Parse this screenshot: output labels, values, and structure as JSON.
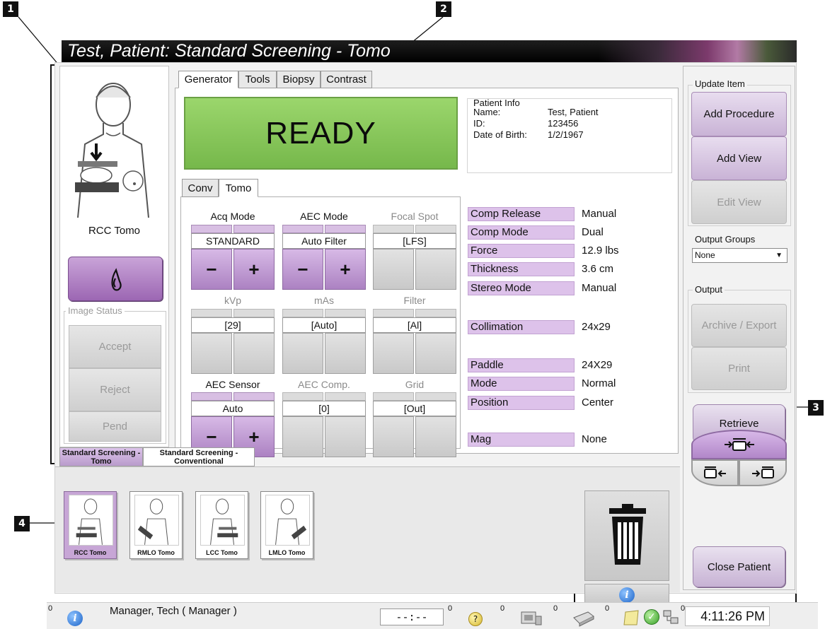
{
  "callouts": [
    "1",
    "2",
    "3",
    "4"
  ],
  "window": {
    "title": "Test, Patient:  Standard Screening - Tomo"
  },
  "left_panel": {
    "view_label": "RCC Tomo",
    "image_status_legend": "Image Status",
    "buttons": {
      "accept": "Accept",
      "reject": "Reject",
      "pend": "Pend"
    }
  },
  "tabs": [
    "Generator",
    "Tools",
    "Biopsy",
    "Contrast"
  ],
  "ready_text": "READY",
  "patient_info": {
    "legend": "Patient Info",
    "name_label": "Name:",
    "name": "Test, Patient",
    "id_label": "ID:",
    "id": "123456",
    "dob_label": "Date of Birth:",
    "dob": "1/2/1967"
  },
  "sub_tabs": [
    "Conv",
    "Tomo"
  ],
  "controls": {
    "acq_mode": {
      "label": "Acq Mode",
      "value": "STANDARD",
      "minus": "−",
      "plus": "+"
    },
    "aec_mode": {
      "label": "AEC Mode",
      "value": "Auto Filter",
      "minus": "−",
      "plus": "+"
    },
    "focal_spot": {
      "label": "Focal Spot",
      "value": "[LFS]"
    },
    "kvp": {
      "label": "kVp",
      "value": "[29]"
    },
    "mas": {
      "label": "mAs",
      "value": "[Auto]"
    },
    "filter": {
      "label": "Filter",
      "value": "[Al]"
    },
    "aec_sensor": {
      "label": "AEC Sensor",
      "value": "Auto",
      "minus": "−",
      "plus": "+"
    },
    "aec_comp": {
      "label": "AEC Comp.",
      "value": "[0]"
    },
    "grid": {
      "label": "Grid",
      "value": "[Out]"
    }
  },
  "settings": [
    {
      "key": "Comp Release",
      "value": "Manual"
    },
    {
      "key": "Comp Mode",
      "value": "Dual"
    },
    {
      "key": "Force",
      "value": "12.9 lbs"
    },
    {
      "key": "Thickness",
      "value": "3.6 cm"
    },
    {
      "key": "Stereo Mode",
      "value": "Manual"
    },
    {
      "key": "Collimation",
      "value": "24x29"
    },
    {
      "key": "Paddle",
      "value": "24X29"
    },
    {
      "key": "Mode",
      "value": "Normal"
    },
    {
      "key": "Position",
      "value": "Center"
    },
    {
      "key": "Mag",
      "value": "None"
    }
  ],
  "right_panel": {
    "update_item_legend": "Update Item",
    "add_procedure": "Add Procedure",
    "add_view": "Add View",
    "edit_view": "Edit View",
    "output_groups_legend": "Output Groups",
    "output_groups_selected": "None",
    "output_legend": "Output",
    "archive_export": "Archive / Export",
    "print": "Print",
    "retrieve": "Retrieve",
    "close_patient": "Close Patient"
  },
  "procedure_tabs": [
    "Standard Screening - Tomo",
    "Standard Screening - Conventional"
  ],
  "thumbnails": [
    "RCC Tomo",
    "RMLO Tomo",
    "LCC Tomo",
    "LMLO Tomo"
  ],
  "status_bar": {
    "user": "Manager, Tech ( Manager )",
    "counter": "--:--",
    "counts": [
      "0",
      "0",
      "0",
      "0",
      "0",
      "0"
    ],
    "time": "4:11:26 PM"
  },
  "colors": {
    "ready_green": "#86c65a",
    "accent_purple": "#b48ac8",
    "setting_key_bg": "#ddc2ea",
    "titlebar": "#000000"
  },
  "icons": [
    "flame-icon",
    "trash-icon",
    "info-icon",
    "help-icon",
    "device-icon",
    "printer-icon",
    "notes-icon",
    "check-icon",
    "network-icon",
    "paddle-shift-icon"
  ]
}
